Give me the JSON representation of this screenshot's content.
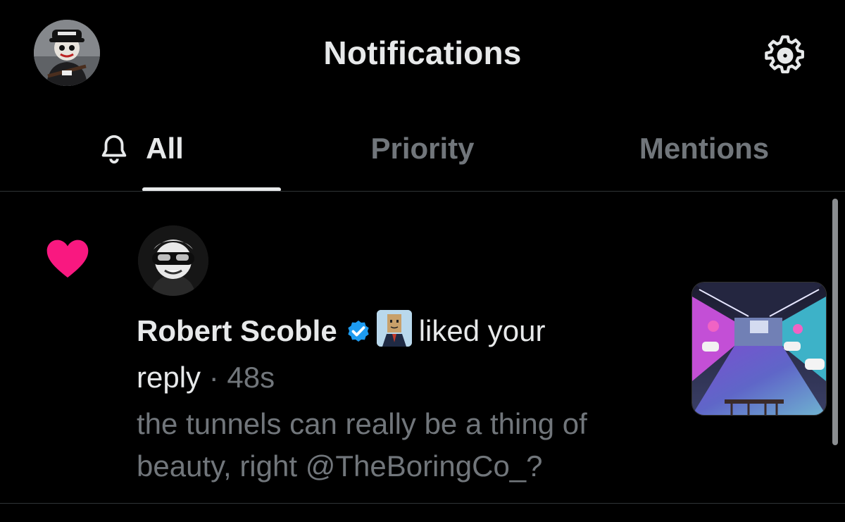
{
  "header": {
    "title": "Notifications",
    "settings_icon": "gear-icon",
    "avatar": "profile-avatar"
  },
  "tabs": [
    {
      "label": "All",
      "icon": "bell-icon",
      "active": true
    },
    {
      "label": "Priority",
      "active": false
    },
    {
      "label": "Mentions",
      "active": false
    }
  ],
  "notification": {
    "type_icon": "heart-icon",
    "actor_name": "Robert Scoble",
    "verified": true,
    "action": "liked your",
    "target": "reply",
    "separator": "·",
    "time_ago": "48s",
    "quoted_text": "the tunnels can really be a thing of beauty, right @TheBoringCo_?",
    "media": "tunnel-thumbnail"
  },
  "colors": {
    "background": "#000000",
    "primary_text": "#e7e9ea",
    "secondary_text": "#71767b",
    "like": "#f91880",
    "verified": "#1d9bf0",
    "divider": "#2f3336"
  }
}
